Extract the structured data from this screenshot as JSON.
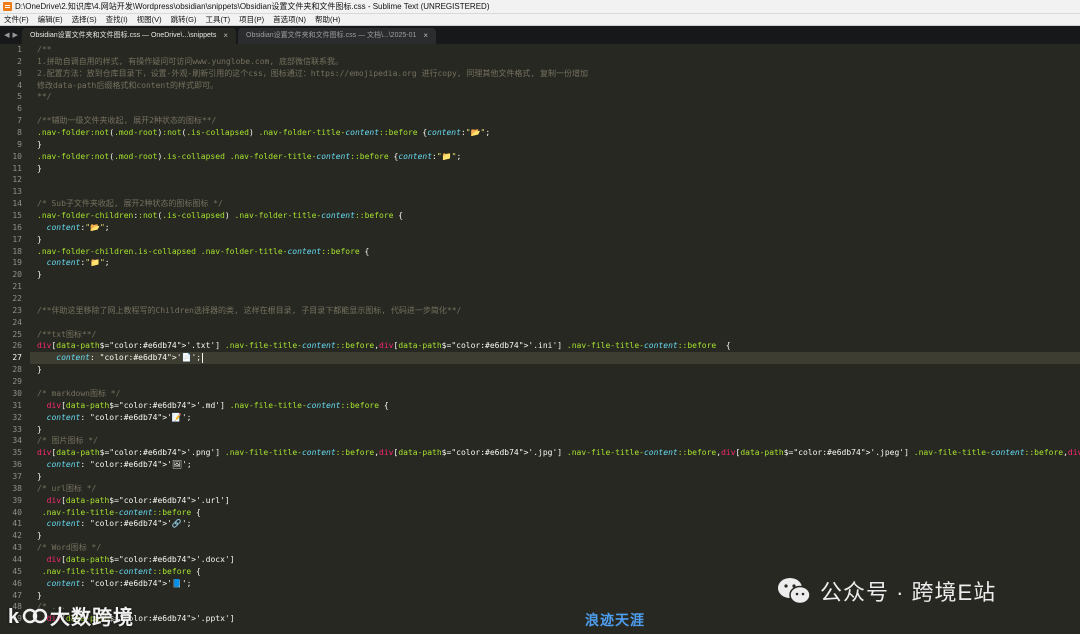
{
  "window": {
    "title": "D:\\OneDrive\\2.知识库\\4.网站开发\\Wordpress\\obsidian\\snippets\\Obsidian设置文件夹和文件图标.css - Sublime Text (UNREGISTERED)"
  },
  "menu": [
    "文件(F)",
    "编辑(E)",
    "选择(S)",
    "查找(I)",
    "视图(V)",
    "跳转(G)",
    "工具(T)",
    "项目(P)",
    "首选项(N)",
    "帮助(H)"
  ],
  "tabs": [
    {
      "label": "Obsidian设置文件夹和文件图标.css — OneDrive\\...\\snippets",
      "active": true,
      "close": "×"
    },
    {
      "label": "Obsidian设置文件夹和文件图标.css — 文档\\...\\2025-01",
      "active": false,
      "close": "×"
    }
  ],
  "tab_nav": {
    "left": "◀",
    "right": "▶"
  },
  "editor": {
    "language": "CSS",
    "theme": "Monokai",
    "current_line": 27,
    "lines": [
      {
        "n": 1,
        "t": "/**"
      },
      {
        "n": 2,
        "t": "1.拼助自调自用的样式, 有操作疑问可访问www.yunglobe.com, 底部微信联系我。"
      },
      {
        "n": 3,
        "t": "2.配置方法：放到仓库目录下，设置-外观-刷新引用的这个css，图标通过：https://emojipedia.org 进行copy, 同理其他文件格式, 复制一份增加"
      },
      {
        "n": 4,
        "t": "修改data-path后缀格式和content的样式即可。"
      },
      {
        "n": 5,
        "t": "**/"
      },
      {
        "n": 6,
        "t": ""
      },
      {
        "n": 7,
        "t": "/**辅助一级文件夹收起, 展开2种状态的图标**/"
      },
      {
        "n": 8,
        "t": ".nav-folder:not(.mod-root):not(.is-collapsed) .nav-folder-title-content::before {content:\"📂\";"
      },
      {
        "n": 9,
        "t": "}"
      },
      {
        "n": 10,
        "t": ".nav-folder:not(.mod-root).is-collapsed .nav-folder-title-content::before {content:\"📁\";"
      },
      {
        "n": 11,
        "t": "}"
      },
      {
        "n": 12,
        "t": ""
      },
      {
        "n": 13,
        "t": ""
      },
      {
        "n": 14,
        "t": "/* Sub子文件夹收起, 展开2种状态的图标图标 */"
      },
      {
        "n": 15,
        "t": ".nav-folder-children::not(.is-collapsed) .nav-folder-title-content::before {"
      },
      {
        "n": 16,
        "t": "  content:\"📂\";"
      },
      {
        "n": 17,
        "t": "}"
      },
      {
        "n": 18,
        "t": ".nav-folder-children.is-collapsed .nav-folder-title-content::before {"
      },
      {
        "n": 19,
        "t": "  content:\"📁\";"
      },
      {
        "n": 20,
        "t": "}"
      },
      {
        "n": 21,
        "t": ""
      },
      {
        "n": 22,
        "t": ""
      },
      {
        "n": 23,
        "t": "/**伴助这里移除了网上教程写的Children选择器的类, 这样在根目录, 子目录下都能显示图标, 代码进一步简化**/"
      },
      {
        "n": 24,
        "t": ""
      },
      {
        "n": 25,
        "t": "/**txt图标**/"
      },
      {
        "n": 26,
        "t": "div[data-path$='.txt'] .nav-file-title-content::before,div[data-path$='.ini'] .nav-file-title-content::before  {"
      },
      {
        "n": 27,
        "t": "    content: '📄';"
      },
      {
        "n": 28,
        "t": "}"
      },
      {
        "n": 29,
        "t": ""
      },
      {
        "n": 30,
        "t": "/* markdown图标 */"
      },
      {
        "n": 31,
        "t": "  div[data-path$='.md'] .nav-file-title-content::before {"
      },
      {
        "n": 32,
        "t": "  content: '📝';"
      },
      {
        "n": 33,
        "t": "}"
      },
      {
        "n": 34,
        "t": "/* 图片图标 */"
      },
      {
        "n": 35,
        "t": "div[data-path$='.png'] .nav-file-title-content::before,div[data-path$='.jpg'] .nav-file-title-content::before,div[data-path$='.jpeg'] .nav-file-title-content::before,div[data-path$='.gif']"
      },
      {
        "n": 36,
        "t": "  content: '🖼';"
      },
      {
        "n": 37,
        "t": "}"
      },
      {
        "n": 38,
        "t": "/* url图标 */"
      },
      {
        "n": 39,
        "t": "  div[data-path$='.url']"
      },
      {
        "n": 40,
        "t": " .nav-file-title-content::before {"
      },
      {
        "n": 41,
        "t": "  content: '🔗';"
      },
      {
        "n": 42,
        "t": "}"
      },
      {
        "n": 43,
        "t": "/* Word图标 */"
      },
      {
        "n": 44,
        "t": "  div[data-path$='.docx']"
      },
      {
        "n": 45,
        "t": " .nav-file-title-content::before {"
      },
      {
        "n": 46,
        "t": "  content: '📘';"
      },
      {
        "n": 47,
        "t": "}"
      },
      {
        "n": 48,
        "t": "/* ..."
      },
      {
        "n": 49,
        "t": "  div[data-path$='.pptx']"
      }
    ]
  },
  "watermarks": {
    "left": "大数跨境",
    "center": "浪迹天涯",
    "right": "公众号 · 跨境E站"
  },
  "colors": {
    "background": "#272822",
    "gutter_text": "#8f908a",
    "comment": "#75715e",
    "selector": "#a6e22e",
    "tag": "#f92672",
    "string": "#e6db74",
    "property": "#66d9ef",
    "current_line": "#3e3d32"
  }
}
